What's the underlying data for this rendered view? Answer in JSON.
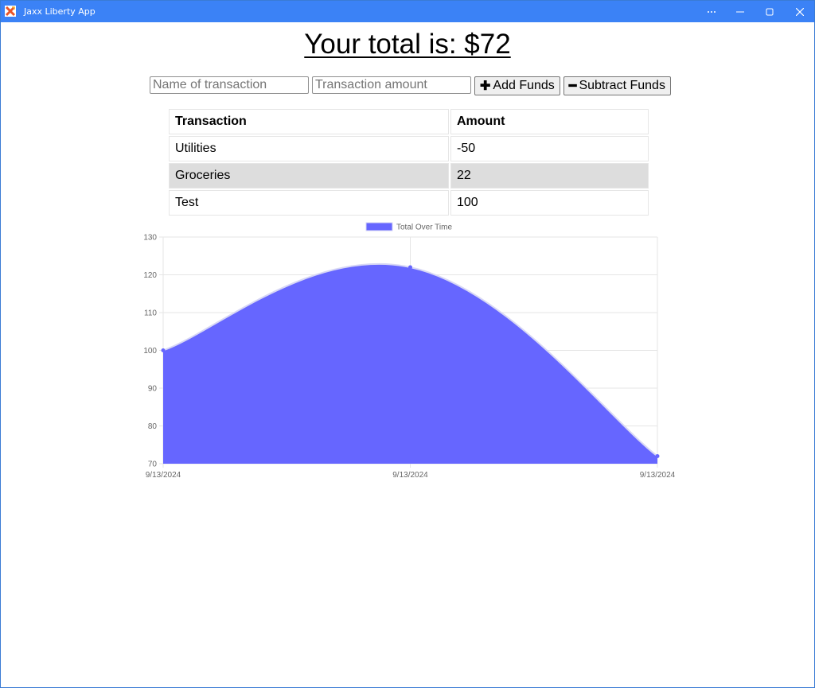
{
  "window": {
    "title": "Jaxx Liberty App",
    "controls": [
      "more-icon",
      "minimize-icon",
      "maximize-icon",
      "close-icon"
    ]
  },
  "header": {
    "total_text": "Your total is: $72"
  },
  "form": {
    "name_placeholder": "Name of transaction",
    "name_value": "",
    "amount_placeholder": "Transaction amount",
    "amount_value": "",
    "add_label": "Add Funds",
    "add_icon": "plus-icon",
    "subtract_label": "Subtract Funds",
    "subtract_icon": "minus-icon"
  },
  "table": {
    "headers": [
      "Transaction",
      "Amount"
    ],
    "rows": [
      [
        "Utilities",
        "-50"
      ],
      [
        "Groceries",
        "22"
      ],
      [
        "Test",
        "100"
      ]
    ]
  },
  "chart_data": {
    "type": "area",
    "title": "",
    "legend": {
      "label": "Total Over Time",
      "position": "top"
    },
    "x": [
      "9/13/2024",
      "9/13/2024",
      "9/13/2024"
    ],
    "series": [
      {
        "name": "Total Over Time",
        "values": [
          100,
          122,
          72
        ],
        "color": "#6666ff"
      }
    ],
    "ylim": [
      70,
      130
    ],
    "yticks": [
      70,
      80,
      90,
      100,
      110,
      120,
      130
    ],
    "xlabel": "",
    "ylabel": "",
    "grid": true,
    "curve": "smooth"
  }
}
